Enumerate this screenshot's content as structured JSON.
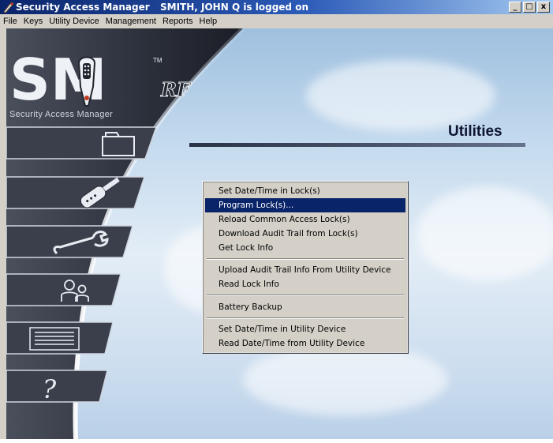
{
  "window": {
    "title": "Security Access Manager",
    "user_status": "SMITH, JOHN Q is logged on",
    "controls": {
      "minimize": "_",
      "maximize": "□",
      "close": "x"
    }
  },
  "menubar": {
    "items": [
      "File",
      "Keys",
      "Utility Device",
      "Management",
      "Reports",
      "Help"
    ]
  },
  "logo": {
    "mark": "SM",
    "tm": "TM",
    "rf": "RF",
    "subtitle": "Security Access Manager"
  },
  "sidebar": {
    "buttons": [
      {
        "name": "folder",
        "icon": "folder-icon"
      },
      {
        "name": "keys",
        "icon": "key-icon"
      },
      {
        "name": "utilities",
        "icon": "wrench-icon"
      },
      {
        "name": "users",
        "icon": "users-icon"
      },
      {
        "name": "reports",
        "icon": "list-icon"
      },
      {
        "name": "help",
        "icon": "question-icon",
        "glyph": "?"
      }
    ]
  },
  "section": {
    "title": "Utilities"
  },
  "popup_menu": {
    "groups": [
      [
        {
          "label": "Set Date/Time in Lock(s)"
        },
        {
          "label": "Program Lock(s)...",
          "active": true
        },
        {
          "label": "Reload Common Access Lock(s)"
        },
        {
          "label": "Download Audit Trail from Lock(s)"
        },
        {
          "label": "Get Lock Info"
        }
      ],
      [
        {
          "label": "Upload Audit Trail Info From Utility Device"
        },
        {
          "label": "Read Lock Info"
        }
      ],
      [
        {
          "label": "Battery Backup"
        }
      ],
      [
        {
          "label": "Set Date/Time in Utility Device"
        },
        {
          "label": "Read Date/Time from Utility Device"
        }
      ]
    ]
  },
  "colors": {
    "titlebar": "#0a246a",
    "menu_highlight": "#0a246a",
    "panel_dark": "#2f3441",
    "chrome": "#d4d0c8"
  }
}
